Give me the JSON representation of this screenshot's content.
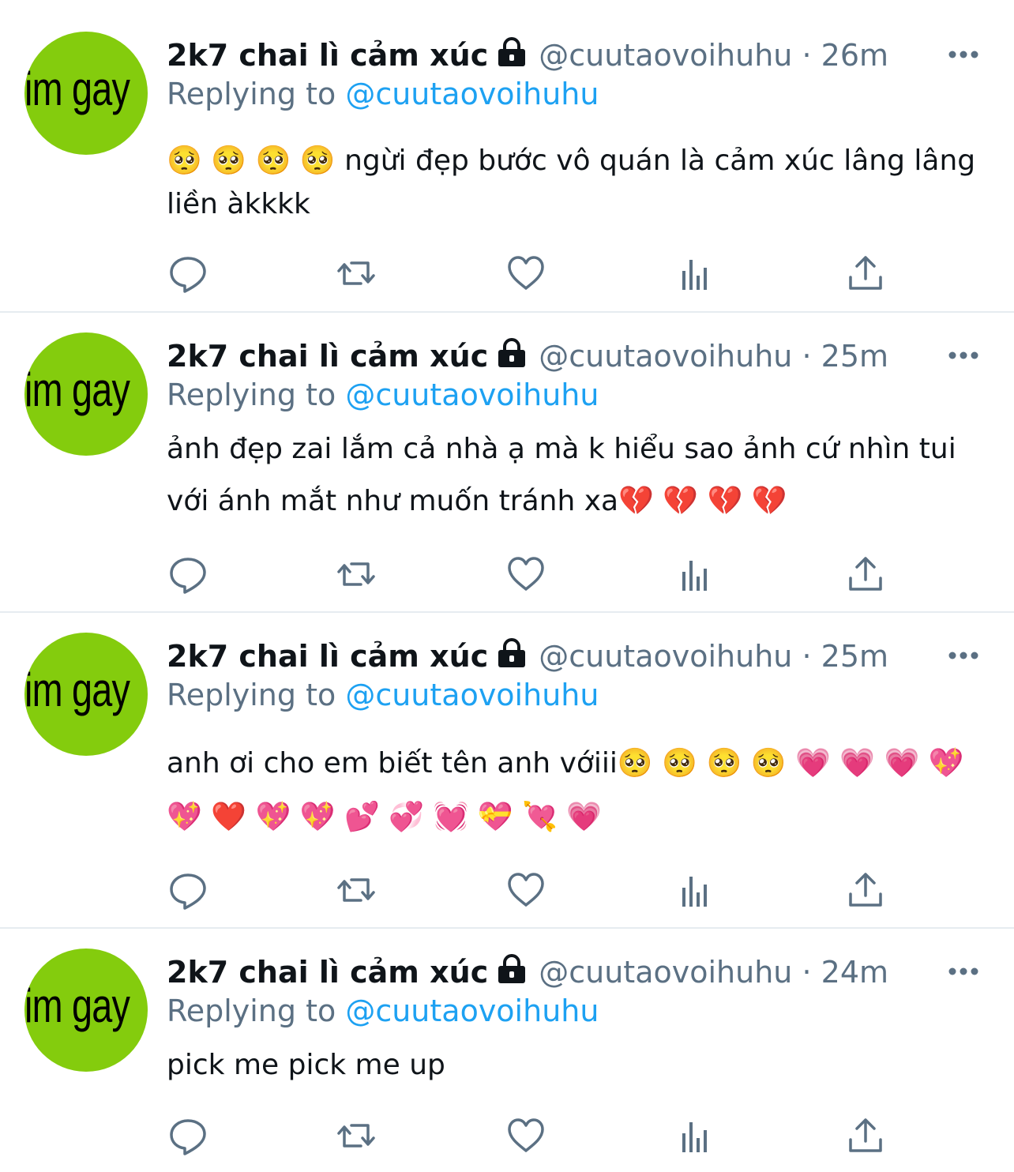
{
  "tweets": [
    {
      "display_name": "2k7 chai lì cảm xúc",
      "handle": "@cuutaovoihuhu",
      "separator": "·",
      "time": "26m",
      "replying_prefix": "Replying to",
      "replying_to": "@cuutaovoihuhu",
      "text": "🥺 🥺 🥺 🥺  ngừi đẹp bước vô quán là cảm xúc lâng lâng liền àkkkk",
      "avatar_text": "im gay"
    },
    {
      "display_name": "2k7 chai lì cảm xúc",
      "handle": "@cuutaovoihuhu",
      "separator": "·",
      "time": "25m",
      "replying_prefix": "Replying to",
      "replying_to": "@cuutaovoihuhu",
      "text": "ảnh đẹp zai lắm cả nhà ạ mà k hiểu sao ảnh cứ nhìn tui với ánh mắt như muốn tránh xa💔 💔 💔 💔",
      "avatar_text": "im gay"
    },
    {
      "display_name": "2k7 chai lì cảm xúc",
      "handle": "@cuutaovoihuhu",
      "separator": "·",
      "time": "25m",
      "replying_prefix": "Replying to",
      "replying_to": "@cuutaovoihuhu",
      "text": "anh ơi cho em biết tên anh vớiii🥺 🥺 🥺 🥺 💗 💗 💗 💖 💖 ❤️ 💖 💖 💕 💞 💓 💝 💘 💗",
      "avatar_text": "im gay"
    },
    {
      "display_name": "2k7 chai lì cảm xúc",
      "handle": "@cuutaovoihuhu",
      "separator": "·",
      "time": "24m",
      "replying_prefix": "Replying to",
      "replying_to": "@cuutaovoihuhu",
      "text": "pick me pick me up",
      "avatar_text": "im gay"
    }
  ],
  "icons": {
    "lock": "lock-icon",
    "more": "more-icon",
    "reply": "reply-icon",
    "retweet": "retweet-icon",
    "like": "like-icon",
    "analytics": "analytics-icon",
    "share": "share-icon"
  },
  "colors": {
    "avatar_bg": "#84cc0d",
    "secondary_text": "#5b7083",
    "link": "#1da1f2",
    "divider": "#e6ecf0",
    "icon": "#5b7083"
  }
}
